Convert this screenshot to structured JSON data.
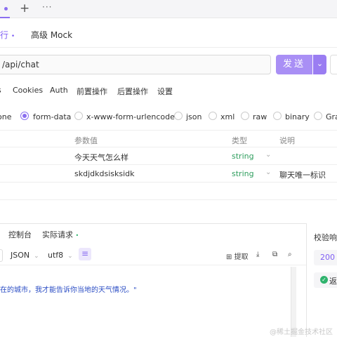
{
  "tabs": {
    "add": "+",
    "more": "···"
  },
  "subtabs": {
    "run": "行",
    "run_dot": "•",
    "mock": "高级 Mock"
  },
  "url": {
    "value": "/api/chat"
  },
  "send": {
    "label": "发送",
    "dropdown": "⌄"
  },
  "request_tabs": [
    "s",
    "Cookies",
    "Auth",
    "前置操作",
    "后置操作",
    "设置"
  ],
  "body_types": [
    {
      "label": "one",
      "selected": false,
      "radio": false
    },
    {
      "label": "form-data",
      "selected": true,
      "radio": true
    },
    {
      "label": "x-www-form-urlencoded",
      "selected": false,
      "radio": true
    },
    {
      "label": "json",
      "selected": false,
      "radio": true
    },
    {
      "label": "xml",
      "selected": false,
      "radio": true
    },
    {
      "label": "raw",
      "selected": false,
      "radio": true
    },
    {
      "label": "binary",
      "selected": false,
      "radio": true
    },
    {
      "label": "Gra",
      "selected": false,
      "radio": true
    }
  ],
  "params_table": {
    "headers": {
      "value": "参数值",
      "type": "类型",
      "desc": "说明"
    },
    "rows": [
      {
        "value": "今天天气怎么样",
        "type": "string",
        "desc": ""
      },
      {
        "value": "skdjdkdsisksidk",
        "type": "string",
        "desc": "聊天唯一标识"
      }
    ]
  },
  "response_tabs": {
    "console": "控制台",
    "actual": "实际请求",
    "actual_dot": "•"
  },
  "response_toolbar": {
    "format": "JSON",
    "encoding": "utf8",
    "extract": "提取"
  },
  "response_content": "在的城市，我才能告诉你当地的天气情况。\"",
  "validation": {
    "label": "校验响应",
    "status_code": "200",
    "result": "返回"
  },
  "watermark": "@稀土掘金技术社区",
  "colors": {
    "accent": "#8b6ff0",
    "send": "#a98ff5",
    "success": "#2fb36d",
    "type": "#2f9e5e"
  }
}
